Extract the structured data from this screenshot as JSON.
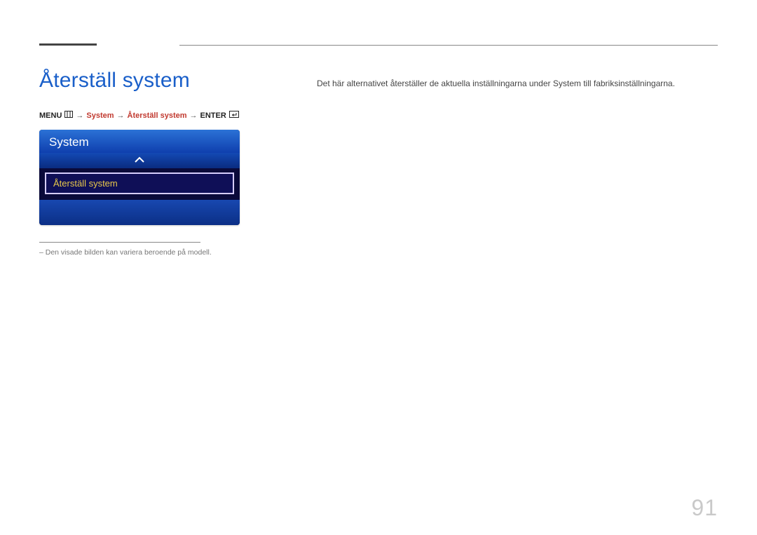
{
  "title": "Återställ system",
  "breadcrumb": {
    "menu_label": "MENU",
    "system_label": "System",
    "reset_label": "Återställ system",
    "enter_label": "ENTER"
  },
  "osd": {
    "header": "System",
    "selected": "Återställ system"
  },
  "note": "– Den visade bilden kan variera beroende på modell.",
  "description": "Det här alternativet återställer de aktuella inställningarna under System till fabriksinställningarna.",
  "page_number": "91"
}
